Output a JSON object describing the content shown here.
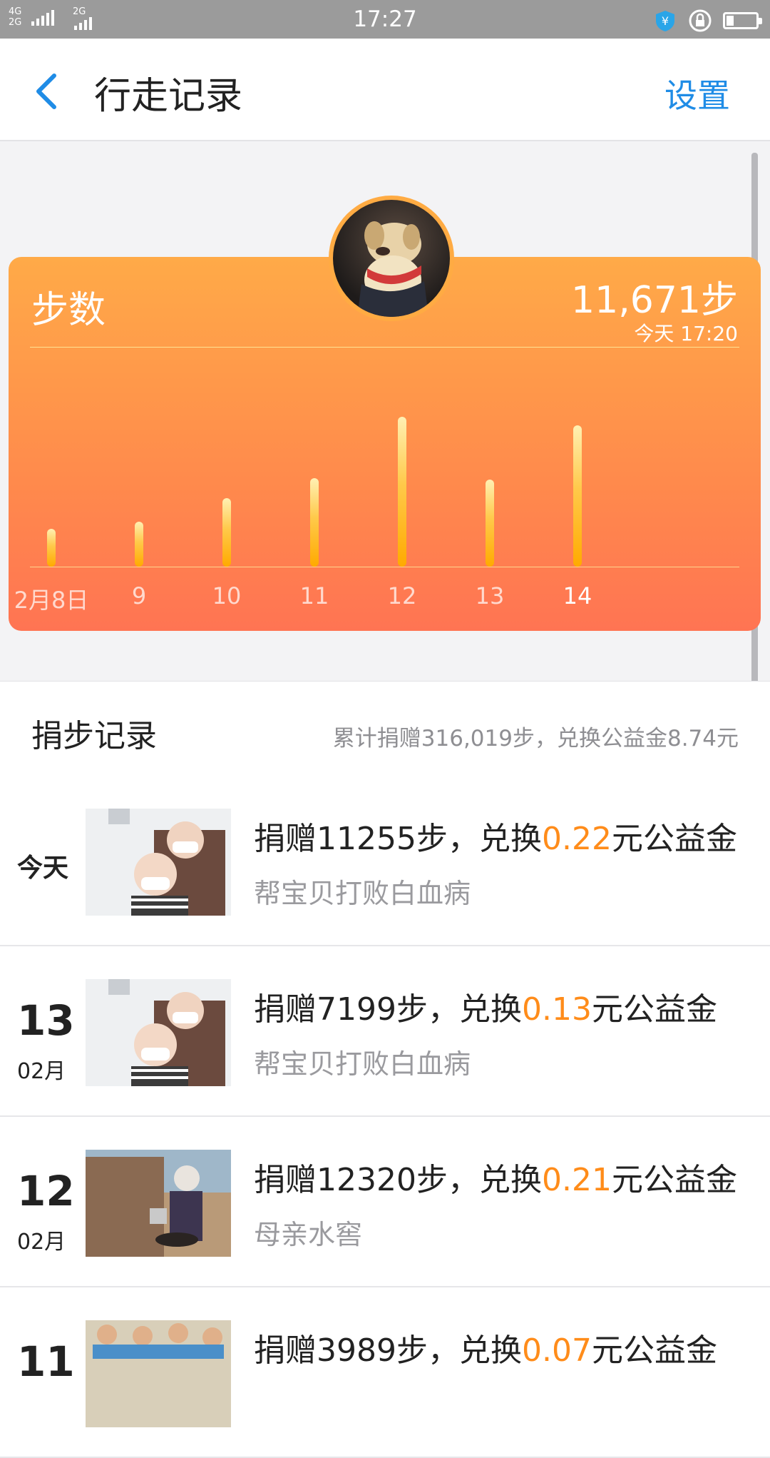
{
  "status_bar": {
    "time": "17:27",
    "network_top": "4G",
    "network_bottom": "2G",
    "network_right": "2G",
    "battery_level": 0.25
  },
  "nav": {
    "title": "行走记录",
    "settings_label": "设置"
  },
  "steps_card": {
    "label": "步数",
    "steps_today": "11,671步",
    "updated": "今天 17:20",
    "days": [
      "2月8日",
      "9",
      "10",
      "11",
      "12",
      "13",
      "14"
    ],
    "today_index": 6
  },
  "chart_data": {
    "type": "bar",
    "categories": [
      "2月8日",
      "9",
      "10",
      "11",
      "12",
      "13",
      "14"
    ],
    "values": [
      2600,
      3100,
      4700,
      6100,
      10300,
      6000,
      9700
    ],
    "ylim": [
      0,
      10300
    ],
    "grid": false
  },
  "records": {
    "title": "捐步记录",
    "summary": "累计捐赠316,019步，兑换公益金8.74元",
    "items": [
      {
        "date_label": "今天",
        "day": "",
        "month": "",
        "prefix": "捐赠11255步，兑换",
        "amount": "0.22",
        "suffix": "元公益金",
        "project": "帮宝贝打败白血病",
        "image": "grandma-baby"
      },
      {
        "date_label": "",
        "day": "13",
        "month": "02月",
        "prefix": "捐赠7199步，兑换",
        "amount": "0.13",
        "suffix": "元公益金",
        "project": "帮宝贝打败白血病",
        "image": "grandma-baby"
      },
      {
        "date_label": "",
        "day": "12",
        "month": "02月",
        "prefix": "捐赠12320步，兑换",
        "amount": "0.21",
        "suffix": "元公益金",
        "project": "母亲水窖",
        "image": "mother-well"
      },
      {
        "date_label": "",
        "day": "11",
        "month": "",
        "prefix": "捐赠3989步，兑换",
        "amount": "0.07",
        "suffix": "元公益金",
        "project": "",
        "image": "children-class"
      }
    ]
  },
  "colors": {
    "accent": "#1f8ce6",
    "orange_amount": "#ff8c1a",
    "card_top": "#ffaa48",
    "card_bottom": "#ff7453"
  }
}
